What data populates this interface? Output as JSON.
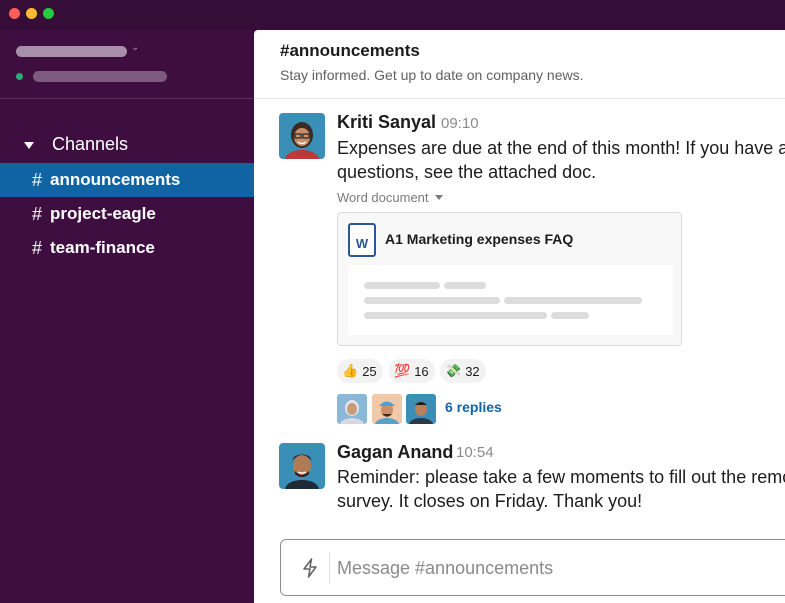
{
  "sidebar": {
    "channels_header": "Channels",
    "channels": [
      {
        "name": "announcements",
        "active": true
      },
      {
        "name": "project-eagle",
        "active": false
      },
      {
        "name": "team-finance",
        "active": false
      }
    ]
  },
  "channel": {
    "title": "#announcements",
    "topic": "Stay informed. Get up to date on company news."
  },
  "messages": [
    {
      "author": "Kriti Sanyal",
      "time": "09:10",
      "lines": [
        "Expenses are due at the end of this month! If you have ar",
        "questions, see the attached doc."
      ],
      "attachment": {
        "type_label": "Word document",
        "icon_letter": "W",
        "title": "A1 Marketing expenses FAQ"
      },
      "reactions": [
        {
          "emoji": "👍",
          "count": "25"
        },
        {
          "emoji": "💯",
          "count": "16"
        },
        {
          "emoji": "💸",
          "count": "32"
        }
      ],
      "replies": "6 replies"
    },
    {
      "author": "Gagan Anand",
      "time": "10:54",
      "lines": [
        "Reminder: please take a few moments to fill out the remo",
        "survey. It closes on Friday. Thank you!"
      ]
    }
  ],
  "composer": {
    "placeholder": "Message #announcements"
  },
  "colors": {
    "sidebar": "#3f0e40",
    "titlebar": "#350d36",
    "active_channel": "#1164a3",
    "link": "#1264a3"
  },
  "icons": {
    "shortcut": "bolt-icon",
    "document": "word-doc-icon",
    "channels_toggle": "caret-down-icon"
  }
}
